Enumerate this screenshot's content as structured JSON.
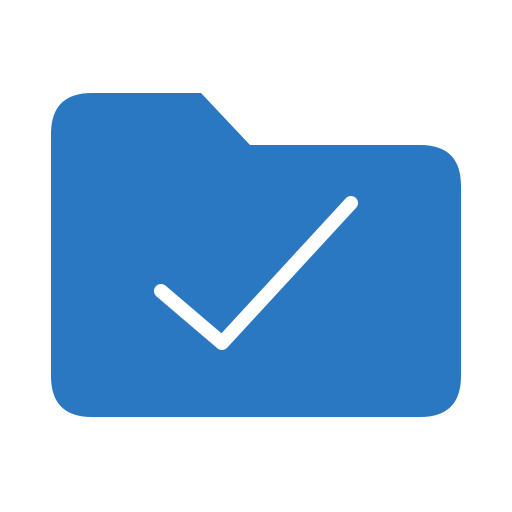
{
  "icon": {
    "name": "folder-check-icon",
    "colors": {
      "folder": "#2b78c2",
      "check": "#ffffff",
      "background": "#ffffff"
    }
  }
}
